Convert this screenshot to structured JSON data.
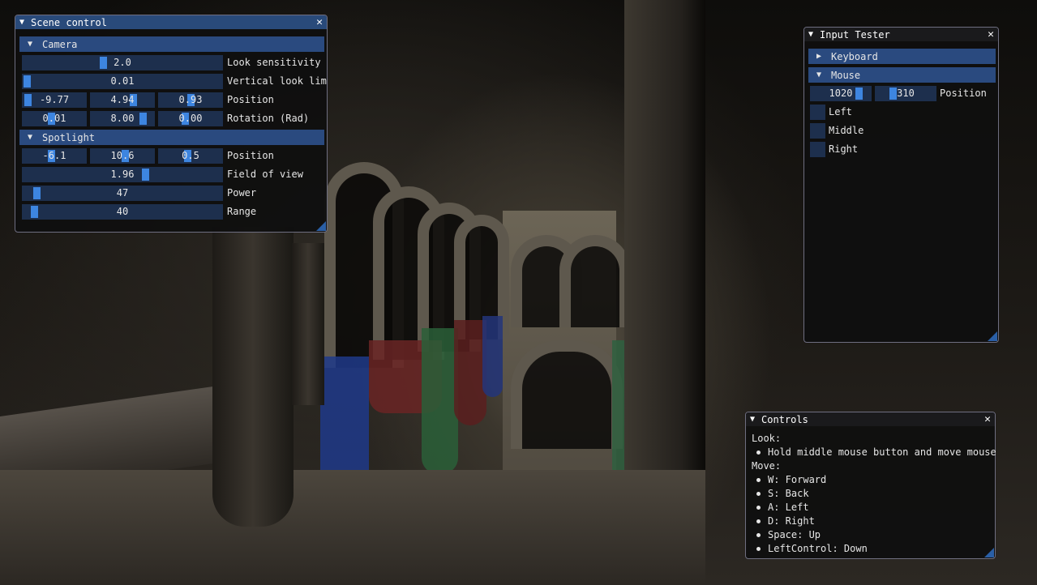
{
  "scene_control": {
    "title": "Scene control",
    "camera": {
      "header": "Camera",
      "look_sensitivity": {
        "value": "2.0",
        "label": "Look sensitivity",
        "fraction": 0.4
      },
      "vertical_look_limit": {
        "value": "0.01",
        "label": "Vertical look lim",
        "fraction": 0.0
      },
      "position": {
        "values": [
          "-9.77",
          "4.94",
          "0.93"
        ],
        "label": "Position",
        "fractions": [
          0.02,
          0.7,
          0.5
        ]
      },
      "rotation": {
        "values": [
          "0.01",
          "8.00",
          "0.00"
        ],
        "label": "Rotation (Rad)",
        "fractions": [
          0.45,
          0.88,
          0.4
        ]
      }
    },
    "spotlight": {
      "header": "Spotlight",
      "position": {
        "values": [
          "-6.1",
          "10.6",
          "0.5"
        ],
        "label": "Position",
        "fractions": [
          0.45,
          0.55,
          0.45
        ]
      },
      "field_of_view": {
        "value": "1.96",
        "label": "Field of view",
        "fraction": 0.62
      },
      "power": {
        "value": "47",
        "label": "Power",
        "fraction": 0.05
      },
      "range": {
        "value": "40",
        "label": "Range",
        "fraction": 0.04
      }
    }
  },
  "input_tester": {
    "title": "Input Tester",
    "keyboard_header": "Keyboard",
    "mouse_header": "Mouse",
    "mouse_position": {
      "x": "1020",
      "y": "310",
      "label": "Position",
      "fractions": [
        0.85,
        0.25
      ]
    },
    "buttons": [
      "Left",
      "Middle",
      "Right"
    ]
  },
  "controls": {
    "title": "Controls",
    "look_heading": "Look:",
    "look_items": [
      "Hold middle mouse button and move mouse"
    ],
    "move_heading": "Move:",
    "move_items": [
      "W: Forward",
      "S: Back",
      "A: Left",
      "D: Right",
      "Space: Up",
      "LeftControl: Down"
    ]
  },
  "colors": {
    "title_bar": "#294a7a",
    "header": "#2a4a7f",
    "frame": "#1d2f4d",
    "slider_grab": "#3d85e0",
    "window_bg": "#0f0f0f"
  },
  "icons": [
    "collapse-triangle-icon",
    "expand-triangle-icon",
    "close-icon",
    "resize-grip-icon",
    "bullet-icon"
  ]
}
